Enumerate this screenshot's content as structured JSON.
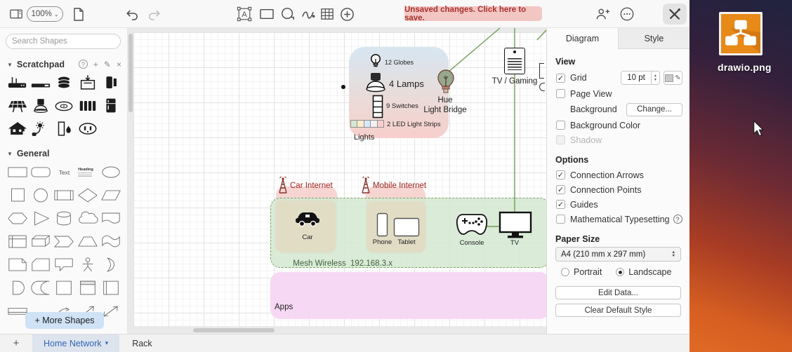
{
  "icons": {
    "chevron_down": "⌄",
    "tab_chevron": "▾",
    "triangle_collapse": "▼",
    "help": "?",
    "add": "+",
    "edit": "✎",
    "close": "×",
    "check": "✓",
    "dots": "⋯",
    "step_up": "▲",
    "step_down": "▼"
  },
  "toolbar": {
    "zoom_value": "100%",
    "unsaved_label": "Unsaved changes. Click here to save."
  },
  "sidebar": {
    "search_placeholder": "Search Shapes",
    "scratchpad": {
      "title": "Scratchpad",
      "icons": [
        "wifi-router",
        "network-switch",
        "disk-stack",
        "shredder",
        "speaker-dock",
        "solar-panel",
        "table-lamp",
        "smoke-detector",
        "radiator",
        "fridge",
        "smart-home",
        "plant-sensor",
        "door-sensor",
        "power-outlet"
      ]
    },
    "general": {
      "title": "General",
      "text_label": "Text",
      "heading_label": "Heading",
      "shapes": [
        "rectangle",
        "rounded-rectangle",
        "text",
        "heading",
        "ellipse",
        "square",
        "circle",
        "process",
        "diamond",
        "parallelogram",
        "hexagon",
        "triangle",
        "cylinder",
        "cloud",
        "document",
        "internal-storage",
        "cube",
        "step",
        "trapezoid",
        "tape",
        "note",
        "card",
        "callout",
        "actor",
        "or",
        "and",
        "data-storage",
        "container",
        "vertical-container",
        "list",
        "horizontal-container",
        "",
        "curve",
        "directional-arrow",
        "bidirectional-arrow"
      ]
    },
    "more_shapes_label": "+ More Shapes"
  },
  "canvas": {
    "lights": {
      "label": "Lights",
      "globes_label": "12 Globes",
      "lamps_label": "4 Lamps",
      "switches_label": "9 Switches",
      "led_label": "2 LED Light Strips",
      "led_colors": [
        "#d5e8d4",
        "#ffeccc",
        "#dae8fc",
        "#f2f2f2",
        "#f8cecc"
      ]
    },
    "hue_bridge_label": "Hue\nLight Bridge",
    "tv_gaming_label": "TV / Gaming",
    "car_internet_label": "Car Internet",
    "mobile_internet_label": "Mobile Internet",
    "mesh": {
      "label": "Mesh Wireless",
      "subnet": "192.168.3.x",
      "devices": [
        {
          "label": "Car"
        },
        {
          "label": "Phone"
        },
        {
          "label": "Tablet"
        },
        {
          "label": "Console"
        },
        {
          "label": "TV"
        }
      ]
    },
    "apps_label": "Apps",
    "edge_color": "#6f9e53"
  },
  "format_panel": {
    "tabs": [
      {
        "label": "Diagram"
      },
      {
        "label": "Style"
      }
    ],
    "view": {
      "heading": "View",
      "grid_label": "Grid",
      "grid_size": "10 pt",
      "page_view_label": "Page View",
      "background_label": "Background",
      "change_button": "Change...",
      "background_color_label": "Background Color",
      "shadow_label": "Shadow"
    },
    "options": {
      "heading": "Options",
      "connection_arrows": "Connection Arrows",
      "connection_points": "Connection Points",
      "guides": "Guides",
      "math_typesetting": "Mathematical Typesetting"
    },
    "paper": {
      "heading": "Paper Size",
      "size_value": "A4 (210 mm x 297 mm)",
      "portrait_label": "Portrait",
      "landscape_label": "Landscape"
    },
    "buttons": {
      "edit_data": "Edit Data...",
      "clear_default_style": "Clear Default Style"
    }
  },
  "page_tabs": {
    "active": "Home Network",
    "other": "Rack"
  },
  "desktop": {
    "file_label": "drawio.png"
  }
}
